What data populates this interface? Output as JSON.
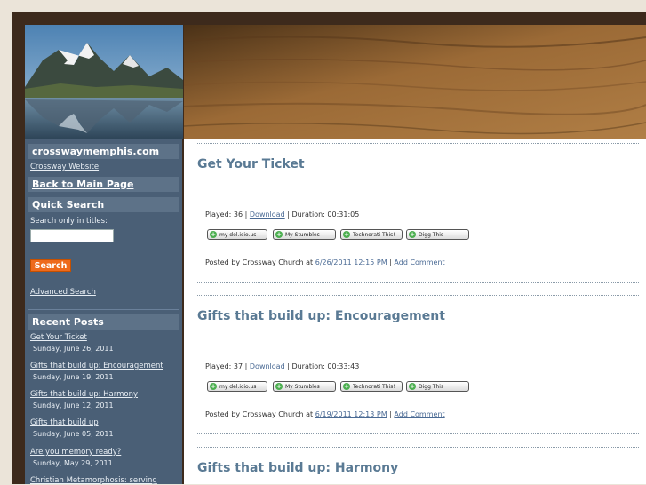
{
  "sidebar": {
    "site_title": "crosswaymemphis.com",
    "site_link": "Crossway Website",
    "back_link": "Back to Main Page",
    "quick_search": {
      "heading": "Quick Search",
      "label": "Search only in titles:",
      "input_value": "",
      "button": "Search",
      "advanced": "Advanced Search"
    },
    "recent_posts": {
      "heading": "Recent Posts",
      "items": [
        {
          "title": "Get Your Ticket",
          "date": "Sunday, June 26, 2011"
        },
        {
          "title": "Gifts that build up: Encouragement",
          "date": "Sunday, June 19, 2011"
        },
        {
          "title": "Gifts that build up: Harmony",
          "date": "Sunday, June 12, 2011"
        },
        {
          "title": "Gifts that build up",
          "date": "Sunday, June 05, 2011"
        },
        {
          "title": "Are you memory ready?",
          "date": "Sunday, May 29, 2011"
        },
        {
          "title": "Christian Metamorphosis: serving",
          "date": ""
        }
      ]
    }
  },
  "social_buttons": [
    "my del.icio.us",
    "My Stumbles",
    "Technorati This!",
    "Digg This"
  ],
  "posts": [
    {
      "title": "Get Your Ticket",
      "played": "Played: 36 |",
      "download": "Download",
      "duration": "| Duration: 00:31:05",
      "posted_prefix": "Posted by Crossway Church at",
      "posted_time": "6/26/2011 12:15 PM",
      "separator": "|",
      "comment": "Add Comment"
    },
    {
      "title": "Gifts that build up: Encouragement",
      "played": "Played: 37 |",
      "download": "Download",
      "duration": "| Duration: 00:33:43",
      "posted_prefix": "Posted by Crossway Church at",
      "posted_time": "6/19/2011 12:13 PM",
      "separator": "|",
      "comment": "Add Comment"
    },
    {
      "title": "Gifts that build up: Harmony"
    }
  ]
}
